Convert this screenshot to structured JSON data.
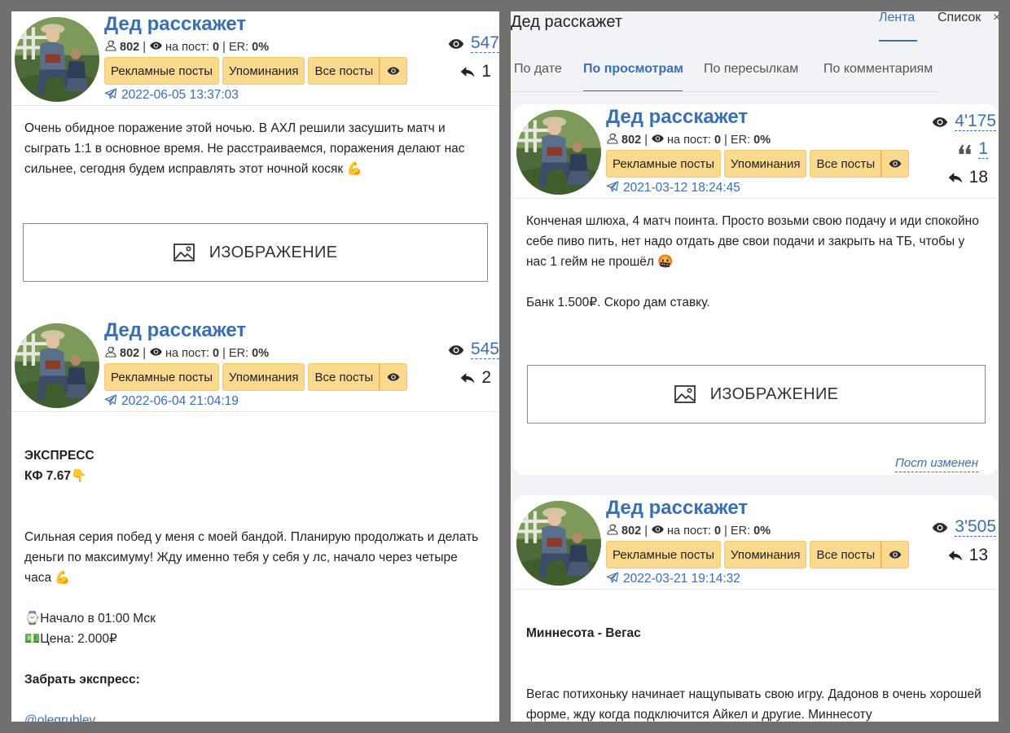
{
  "common": {
    "subscribers": "802",
    "per_post_label": "на пост:",
    "per_post": "0",
    "er_label": "ER:",
    "er": "0%",
    "btn_ads": "Рекламные посты",
    "btn_mentions": "Упоминания",
    "btn_all": "Все посты",
    "image_label": "ИЗОБРАЖЕНИЕ",
    "accent_color": "#3a6fb0",
    "button_color": "#fbd98e"
  },
  "right_header": {
    "title": "Дед расскажет",
    "tab_feed": "Лента",
    "tab_list": "Список",
    "close": "×",
    "sort_date": "По дате",
    "sort_views": "По просмотрам",
    "sort_forwards": "По пересылкам",
    "sort_comments": "По комментариям"
  },
  "posts": [
    {
      "channel": "Дед расскажет",
      "date": "2022-06-05 13:37:03",
      "views": "547",
      "forwards": "1",
      "text1": "Очень обидное поражение этой ночью. В АХЛ решили засушить матч и сыграть 1:1 в основное время. Не расстраиваемся, поражения делают нас сильнее, сегодня будем исправлять этот ночной косяк 💪"
    },
    {
      "channel": "Дед расскажет",
      "date": "2022-06-04 21:04:19",
      "views": "545",
      "forwards": "2",
      "heading1": "ЭКСПРЕСС",
      "heading2": "КФ 7.67👇",
      "text1": "Сильная серия побед у меня с моей бандой. Планирую продолжать и делать деньги по максимуму! Жду именно тебя у себя у лс, начало через четыре часа 💪",
      "line1": "⌚Начало в 01:00 Мск",
      "line2": "💵Цена: 2.000₽",
      "bold_line": "Забрать экспресс:",
      "link": "@olegrublev"
    },
    {
      "channel": "Дед расскажет",
      "date": "2021-03-12 18:24:45",
      "views": "4'175",
      "quotes": "1",
      "forwards": "18",
      "text1": "Конченая шлюха, 4 матч поинта. Просто возьми свою подачу и иди спокойно себе пиво пить, нет надо отдать две свои подачи и закрыть на ТБ, чтобы у нас 1 гейм не прошёл 🤬",
      "text2": "Банк 1.500₽. Скоро дам ставку.",
      "edited": "Пост изменен"
    },
    {
      "channel": "Дед расскажет",
      "date": "2022-03-21 19:14:32",
      "views": "3'505",
      "forwards": "13",
      "heading1": "Миннесота - Вегас",
      "text1": "Вегас потихоньку начинает нащупывать свою игру. Дадонов в очень хорошей форме, жду когда подключится Айкел и другие. Миннесоту"
    }
  ]
}
